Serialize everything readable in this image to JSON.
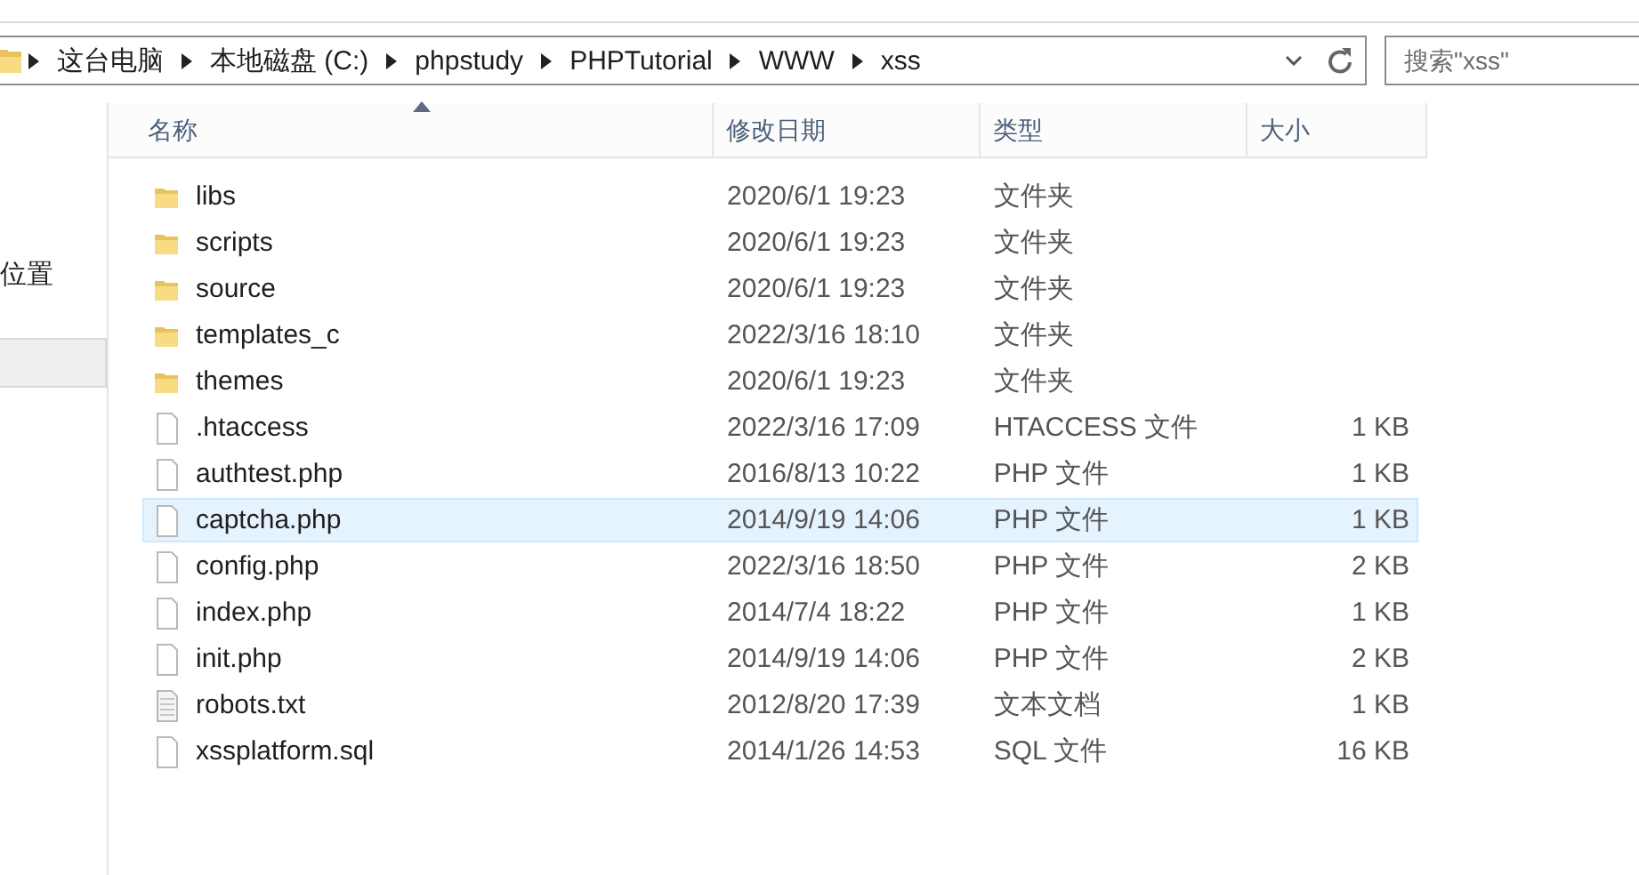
{
  "address_bar": {
    "crumbs": [
      "这台电脑",
      "本地磁盘 (C:)",
      "phpstudy",
      "PHPTutorial",
      "WWW",
      "xss"
    ]
  },
  "search": {
    "placeholder": "搜索\"xss\""
  },
  "sidebar": {
    "items": [
      {
        "label": "位置",
        "selected": false
      },
      {
        "selected": true
      }
    ]
  },
  "table": {
    "columns": [
      "名称",
      "修改日期",
      "类型",
      "大小"
    ],
    "rows": [
      {
        "kind": "folder",
        "name": "libs",
        "date": "2020/6/1 19:23",
        "type": "文件夹",
        "highlighted": false
      },
      {
        "kind": "folder",
        "name": "scripts",
        "date": "2020/6/1 19:23",
        "type": "文件夹",
        "highlighted": false
      },
      {
        "kind": "folder",
        "name": "source",
        "date": "2020/6/1 19:23",
        "type": "文件夹",
        "highlighted": false
      },
      {
        "kind": "folder",
        "name": "templates_c",
        "date": "2022/3/16 18:10",
        "type": "文件夹",
        "highlighted": false
      },
      {
        "kind": "folder",
        "name": "themes",
        "date": "2020/6/1 19:23",
        "type": "文件夹",
        "highlighted": false
      },
      {
        "kind": "file",
        "name": ".htaccess",
        "date": "2022/3/16 17:09",
        "type": "HTACCESS 文件",
        "size": "1 KB",
        "highlighted": false
      },
      {
        "kind": "file",
        "name": "authtest.php",
        "date": "2016/8/13 10:22",
        "type": "PHP 文件",
        "size": "1 KB",
        "highlighted": false
      },
      {
        "kind": "file",
        "name": "captcha.php",
        "date": "2014/9/19 14:06",
        "type": "PHP 文件",
        "size": "1 KB",
        "highlighted": true
      },
      {
        "kind": "file",
        "name": "config.php",
        "date": "2022/3/16 18:50",
        "type": "PHP 文件",
        "size": "2 KB",
        "highlighted": false
      },
      {
        "kind": "file",
        "name": "index.php",
        "date": "2014/7/4 18:22",
        "type": "PHP 文件",
        "size": "1 KB",
        "highlighted": false
      },
      {
        "kind": "file",
        "name": "init.php",
        "date": "2014/9/19 14:06",
        "type": "PHP 文件",
        "size": "2 KB",
        "highlighted": false
      },
      {
        "kind": "text",
        "name": "robots.txt",
        "date": "2012/8/20 17:39",
        "type": "文本文档",
        "size": "1 KB",
        "highlighted": false
      },
      {
        "kind": "file",
        "name": "xssplatform.sql",
        "date": "2014/1/26 14:53",
        "type": "SQL 文件",
        "size": "16 KB",
        "highlighted": false
      }
    ]
  }
}
